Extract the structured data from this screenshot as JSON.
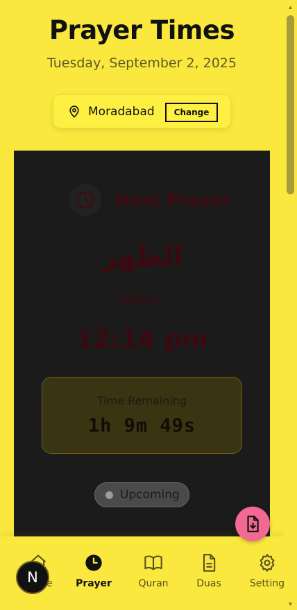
{
  "header": {
    "title": "Prayer Times",
    "date": "Tuesday, September 2, 2025"
  },
  "location": {
    "icon": "map-pin-icon",
    "name": "Moradabad",
    "change_label": "Change"
  },
  "next_prayer": {
    "icon": "clock-icon",
    "label": "Next Prayer",
    "arabic_name": "الظهر",
    "english_name": "Dhuhr",
    "time": "12:14 pm",
    "remaining_label": "Time Remaining",
    "countdown": "1h 9m 49s",
    "status": "Upcoming"
  },
  "fab": {
    "icon": "file-download-icon"
  },
  "nav": {
    "items": [
      {
        "label": "Home",
        "icon": "home-icon",
        "active": false
      },
      {
        "label": "Prayer",
        "icon": "clock-icon",
        "active": true
      },
      {
        "label": "Quran",
        "icon": "book-icon",
        "active": false
      },
      {
        "label": "Duas",
        "icon": "document-icon",
        "active": false
      },
      {
        "label": "Setting",
        "icon": "gear-icon",
        "active": false
      }
    ]
  },
  "avatar": {
    "letter": "N"
  },
  "colors": {
    "background": "#fbe83e",
    "card": "#1b1b1b",
    "accent_text": "#3b0a10",
    "fab": "#f26a92"
  }
}
